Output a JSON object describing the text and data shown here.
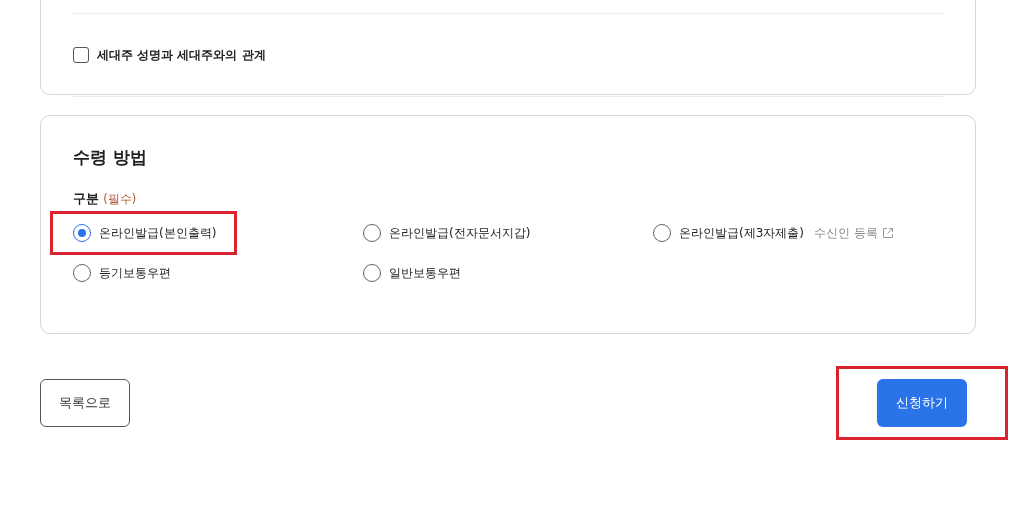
{
  "upper_section": {
    "checkbox": {
      "label": "세대주 성명과 세대주와의 관계",
      "checked": false
    }
  },
  "receipt_section": {
    "title": "수령 방법",
    "field_label": "구분",
    "required_tag": "(필수)",
    "options": [
      {
        "label": "온라인발급(본인출력)",
        "selected": true,
        "highlighted": true
      },
      {
        "label": "온라인발급(전자문서지갑)",
        "selected": false,
        "highlighted": false
      },
      {
        "label": "온라인발급(제3자제출)",
        "selected": false,
        "highlighted": false,
        "link": "수신인 등록"
      },
      {
        "label": "등기보통우편",
        "selected": false,
        "highlighted": false
      },
      {
        "label": "일반보통우편",
        "selected": false,
        "highlighted": false
      }
    ]
  },
  "buttons": {
    "back": {
      "label": "목록으로"
    },
    "submit": {
      "label": "신청하기",
      "highlighted": true
    }
  }
}
